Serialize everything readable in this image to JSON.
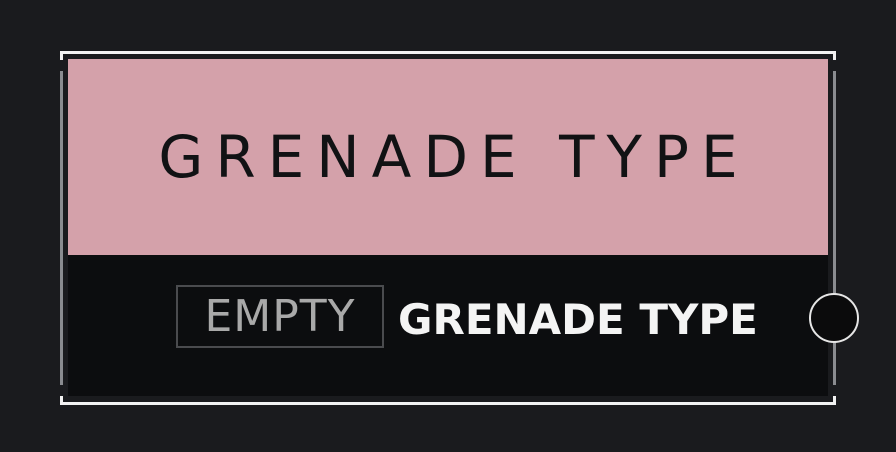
{
  "setting": {
    "title": "GRENADE TYPE",
    "badge": "EMPTY",
    "value": "GRENADE TYPE",
    "knob_icon": "circle-toggle-icon"
  },
  "colors": {
    "background": "#1a1b1e",
    "header_bg": "#d4a1aa",
    "value_bg": "#0c0d0f",
    "badge_text": "#a9a9a9",
    "value_text": "#f4f4f4"
  }
}
